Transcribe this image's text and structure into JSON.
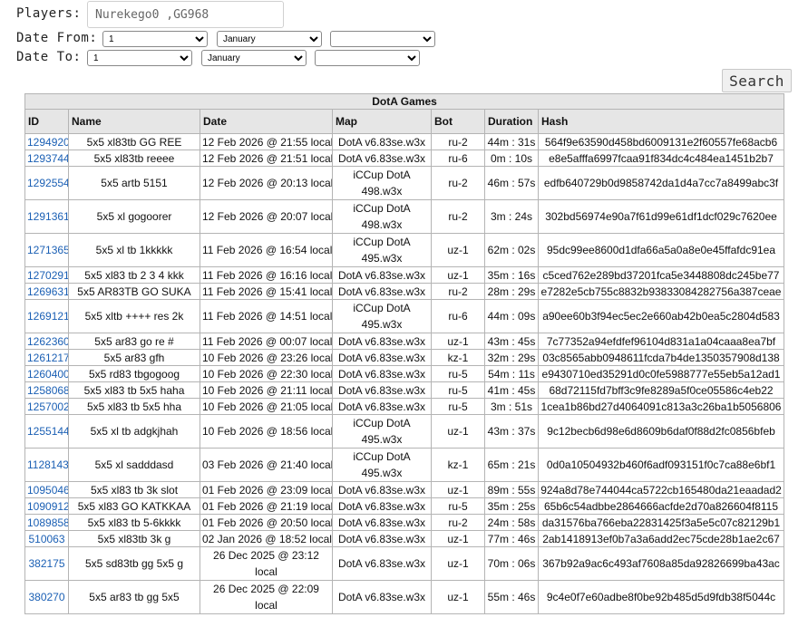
{
  "filters": {
    "players_label": "Players:",
    "players_value": "Nurekego0 ,GG968",
    "date_from_label": "Date From:",
    "date_to_label": "Date To:",
    "from_day": "1",
    "from_month": "January",
    "from_year": "",
    "to_day": "1",
    "to_month": "January",
    "to_year": "",
    "search_label": "Search"
  },
  "table": {
    "caption": "DotA Games",
    "columns": [
      "ID",
      "Name",
      "Date",
      "Map",
      "Bot",
      "Duration",
      "Hash"
    ],
    "rows": [
      {
        "id": "1294920",
        "name": "5x5 xl83tb GG REE",
        "date": "12 Feb 2026 @ 21:55 local",
        "map": "DotA v6.83se.w3x",
        "bot": "ru-2",
        "duration": "44m : 31s",
        "hash": "564f9e63590d458bd6009131e2f60557fe68acb6",
        "tall": false
      },
      {
        "id": "1293744",
        "name": "5x5 xl83tb reeee",
        "date": "12 Feb 2026 @ 21:51 local",
        "map": "DotA v6.83se.w3x",
        "bot": "ru-6",
        "duration": "0m : 10s",
        "hash": "e8e5afffa6997fcaa91f834dc4c484ea1451b2b7",
        "tall": false
      },
      {
        "id": "1292554",
        "name": "5x5 artb 5151",
        "date": "12 Feb 2026 @ 20:13 local",
        "map": "iCCup DotA 498.w3x",
        "bot": "ru-2",
        "duration": "46m : 57s",
        "hash": "edfb640729b0d9858742da1d4a7cc7a8499abc3f",
        "tall": true
      },
      {
        "id": "1291361",
        "name": "5x5 xl gogoorer",
        "date": "12 Feb 2026 @ 20:07 local",
        "map": "iCCup DotA 498.w3x",
        "bot": "ru-2",
        "duration": "3m : 24s",
        "hash": "302bd56974e90a7f61d99e61df1dcf029c7620ee",
        "tall": true
      },
      {
        "id": "1271365",
        "name": "5x5 xl tb 1kkkkk",
        "date": "11 Feb 2026 @ 16:54 local",
        "map": "iCCup DotA 495.w3x",
        "bot": "uz-1",
        "duration": "62m : 02s",
        "hash": "95dc99ee8600d1dfa66a5a0a8e0e45ffafdc91ea",
        "tall": true
      },
      {
        "id": "1270291",
        "name": "5x5 xl83 tb 2 3 4 kkk",
        "date": "11 Feb 2026 @ 16:16 local",
        "map": "DotA v6.83se.w3x",
        "bot": "uz-1",
        "duration": "35m : 16s",
        "hash": "c5ced762e289bd37201fca5e3448808dc245be77",
        "tall": false
      },
      {
        "id": "1269631",
        "name": "5x5 AR83TB GO SUKA",
        "date": "11 Feb 2026 @ 15:41 local",
        "map": "DotA v6.83se.w3x",
        "bot": "ru-2",
        "duration": "28m : 29s",
        "hash": "e7282e5cb755c8832b93833084282756a387ceae",
        "tall": false
      },
      {
        "id": "1269121",
        "name": "5x5 xltb ++++ res 2k",
        "date": "11 Feb 2026 @ 14:51 local",
        "map": "iCCup DotA 495.w3x",
        "bot": "ru-6",
        "duration": "44m : 09s",
        "hash": "a90ee60b3f94ec5ec2e660ab42b0ea5c2804d583",
        "tall": true
      },
      {
        "id": "1262360",
        "name": "5x5 ar83 go re #",
        "date": "11 Feb 2026 @ 00:07 local",
        "map": "DotA v6.83se.w3x",
        "bot": "uz-1",
        "duration": "43m : 45s",
        "hash": "7c77352a94efdfef96104d831a1a04caaa8ea7bf",
        "tall": false
      },
      {
        "id": "1261217",
        "name": "5x5 ar83 gfh",
        "date": "10 Feb 2026 @ 23:26 local",
        "map": "DotA v6.83se.w3x",
        "bot": "kz-1",
        "duration": "32m : 29s",
        "hash": "03c8565abb0948611fcda7b4de1350357908d138",
        "tall": false
      },
      {
        "id": "1260400",
        "name": "5x5 rd83 tbgogoog",
        "date": "10 Feb 2026 @ 22:30 local",
        "map": "DotA v6.83se.w3x",
        "bot": "ru-5",
        "duration": "54m : 11s",
        "hash": "e9430710ed35291d0c0fe5988777e55eb5a12ad1",
        "tall": false
      },
      {
        "id": "1258068",
        "name": "5x5 xl83 tb 5x5 haha",
        "date": "10 Feb 2026 @ 21:11 local",
        "map": "DotA v6.83se.w3x",
        "bot": "ru-5",
        "duration": "41m : 45s",
        "hash": "68d72115fd7bff3c9fe8289a5f0ce05586c4eb22",
        "tall": false
      },
      {
        "id": "1257002",
        "name": "5x5 xl83 tb 5x5 hha",
        "date": "10 Feb 2026 @ 21:05 local",
        "map": "DotA v6.83se.w3x",
        "bot": "ru-5",
        "duration": "3m : 51s",
        "hash": "1cea1b86bd27d4064091c813a3c26ba1b5056806",
        "tall": false
      },
      {
        "id": "1255144",
        "name": "5x5 xl tb adgkjhah",
        "date": "10 Feb 2026 @ 18:56 local",
        "map": "iCCup DotA 495.w3x",
        "bot": "uz-1",
        "duration": "43m : 37s",
        "hash": "9c12becb6d98e6d8609b6daf0f88d2fc0856bfeb",
        "tall": true
      },
      {
        "id": "1128143",
        "name": "5x5 xl sadddasd",
        "date": "03 Feb 2026 @ 21:40 local",
        "map": "iCCup DotA 495.w3x",
        "bot": "kz-1",
        "duration": "65m : 21s",
        "hash": "0d0a10504932b460f6adf093151f0c7ca88e6bf1",
        "tall": true
      },
      {
        "id": "1095046",
        "name": "5x5 xl83 tb 3k slot",
        "date": "01 Feb 2026 @ 23:09 local",
        "map": "DotA v6.83se.w3x",
        "bot": "uz-1",
        "duration": "89m : 55s",
        "hash": "924a8d78e744044ca5722cb165480da21eaadad2",
        "tall": false
      },
      {
        "id": "1090912",
        "name": "5x5 xl83 GO KATKKAA",
        "date": "01 Feb 2026 @ 21:19 local",
        "map": "DotA v6.83se.w3x",
        "bot": "ru-5",
        "duration": "35m : 25s",
        "hash": "65b6c54adbbe2864666acfde2d70a826604f8115",
        "tall": false
      },
      {
        "id": "1089858",
        "name": "5x5 xl83 tb 5-6kkkk",
        "date": "01 Feb 2026 @ 20:50 local",
        "map": "DotA v6.83se.w3x",
        "bot": "ru-2",
        "duration": "24m : 58s",
        "hash": "da31576ba766eba22831425f3a5e5c07c82129b1",
        "tall": false
      },
      {
        "id": "510063",
        "name": "5x5 xl83tb 3k g",
        "date": "02 Jan 2026 @ 18:52 local",
        "map": "DotA v6.83se.w3x",
        "bot": "uz-1",
        "duration": "77m : 46s",
        "hash": "2ab1418913ef0b7a3a6add2ec75cde28b1ae2c67",
        "tall": false
      },
      {
        "id": "382175",
        "name": "5x5 sd83tb gg 5x5 g",
        "date": "26 Dec 2025 @ 23:12 local",
        "map": "DotA v6.83se.w3x",
        "bot": "uz-1",
        "duration": "70m : 06s",
        "hash": "367b92a9ac6c493af7608a85da92826699ba43ac",
        "tall": true
      },
      {
        "id": "380270",
        "name": "5x5 ar83 tb gg 5x5",
        "date": "26 Dec 2025 @ 22:09 local",
        "map": "DotA v6.83se.w3x",
        "bot": "uz-1",
        "duration": "55m : 46s",
        "hash": "9c4e0f7e60adbe8f0be92b485d5d9fdb38f5044c",
        "tall": true
      }
    ]
  }
}
